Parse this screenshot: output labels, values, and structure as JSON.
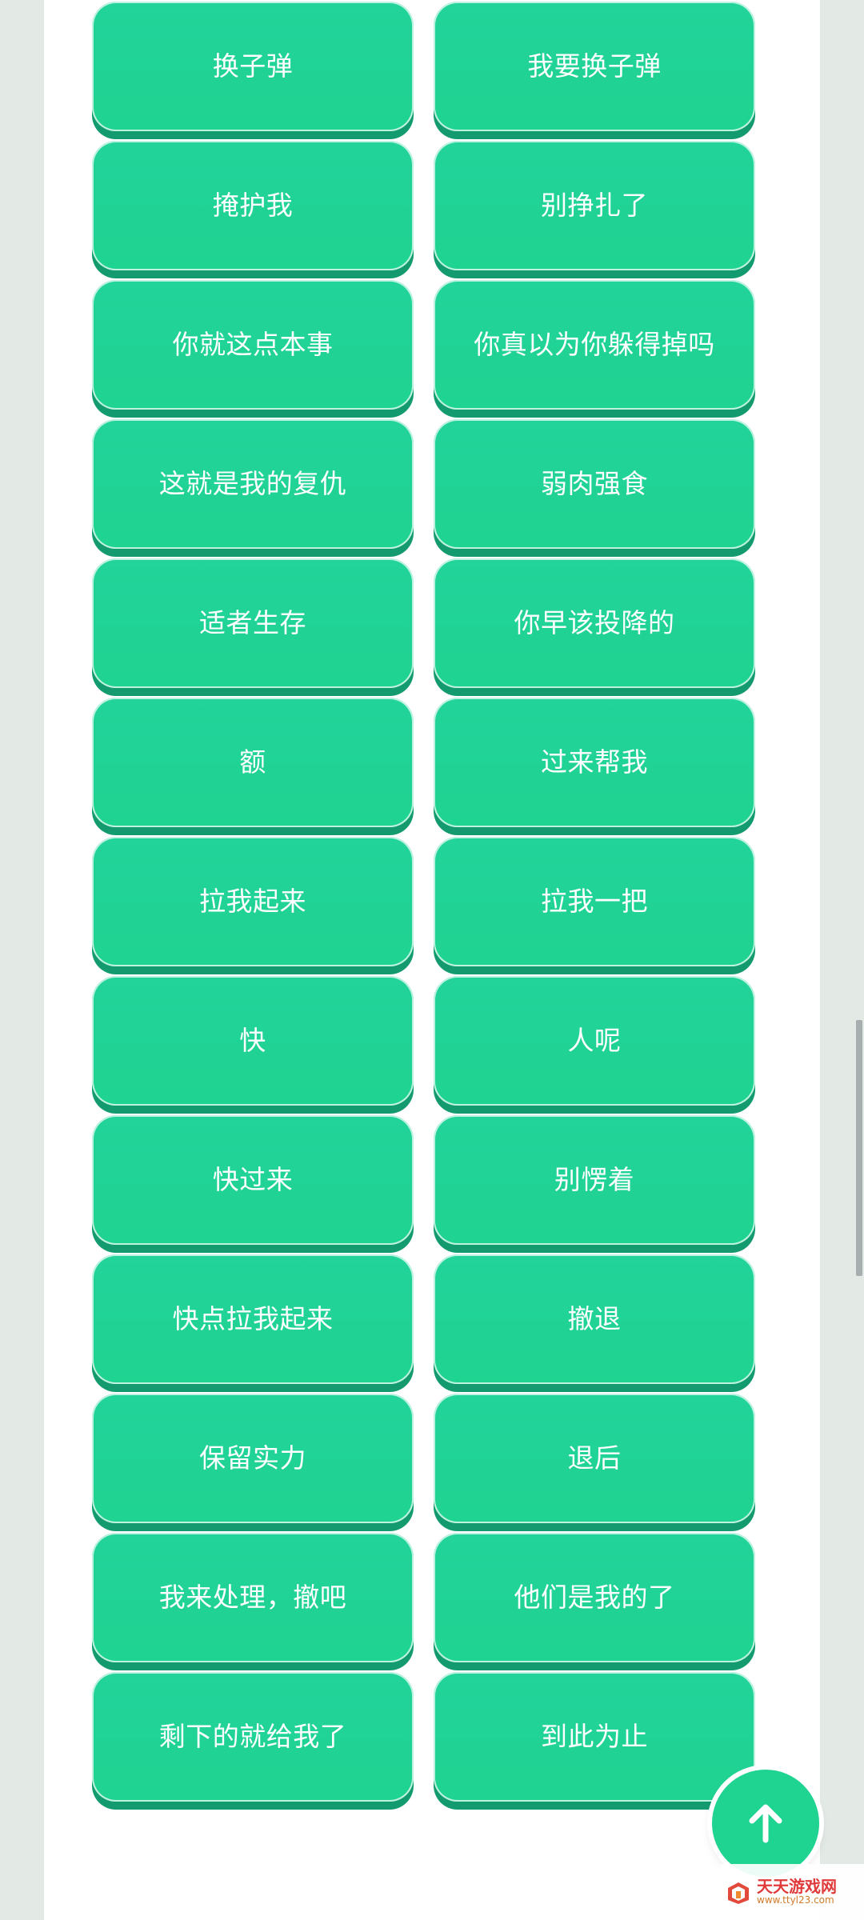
{
  "buttons": [
    {
      "label": "换子弹"
    },
    {
      "label": "我要换子弹"
    },
    {
      "label": "掩护我"
    },
    {
      "label": "别挣扎了"
    },
    {
      "label": "你就这点本事"
    },
    {
      "label": "你真以为你躲得掉吗"
    },
    {
      "label": "这就是我的复仇"
    },
    {
      "label": "弱肉强食"
    },
    {
      "label": "适者生存"
    },
    {
      "label": "你早该投降的"
    },
    {
      "label": "额"
    },
    {
      "label": "过来帮我"
    },
    {
      "label": "拉我起来"
    },
    {
      "label": "拉我一把"
    },
    {
      "label": "快"
    },
    {
      "label": "人呢"
    },
    {
      "label": "快过来"
    },
    {
      "label": "别愣着"
    },
    {
      "label": "快点拉我起来"
    },
    {
      "label": "撤退"
    },
    {
      "label": "保留实力"
    },
    {
      "label": "退后"
    },
    {
      "label": "我来处理，撤吧"
    },
    {
      "label": "他们是我的了"
    },
    {
      "label": "剩下的就给我了"
    },
    {
      "label": "到此为止"
    }
  ],
  "back_to_top": {
    "icon": "arrow-up-icon"
  },
  "watermark": {
    "title": "天天游戏网",
    "url": "www.ttyl23.com"
  },
  "colors": {
    "button": "#1fd391",
    "button_shadow": "#139a6e",
    "page_bg": "#ffffff",
    "outer_bg": "#e3e9e5"
  }
}
